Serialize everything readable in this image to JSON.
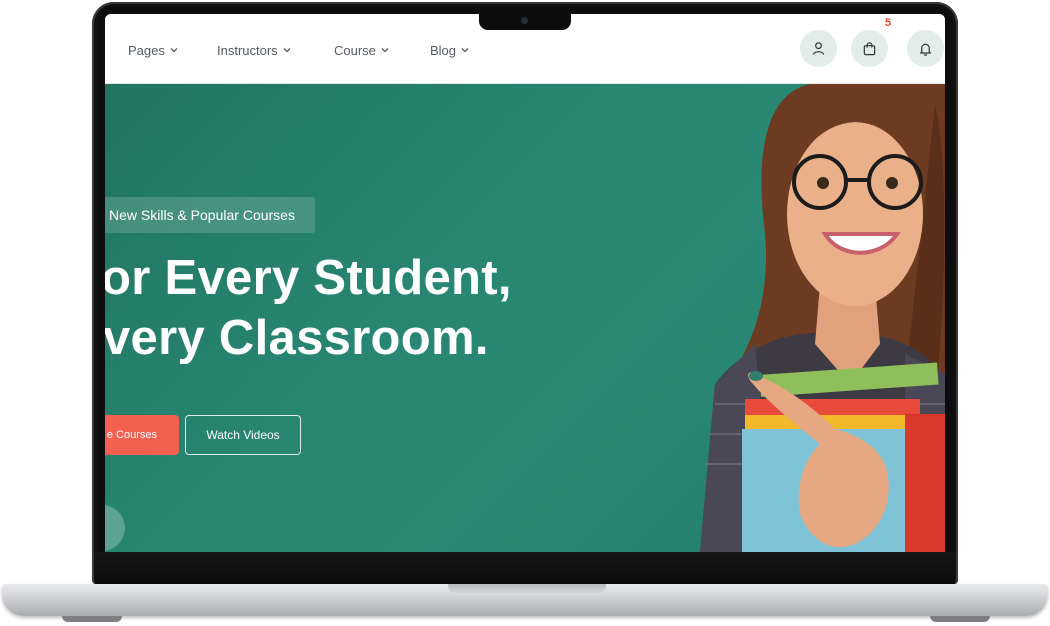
{
  "nav": {
    "items": [
      {
        "label": "Pages"
      },
      {
        "label": "Instructors"
      },
      {
        "label": "Course"
      },
      {
        "label": "Blog"
      }
    ],
    "cart_count": "5"
  },
  "hero": {
    "tag": "New Skills & Popular Courses",
    "headline_line1": "or Every Student,",
    "headline_line2": "very Classroom.",
    "primary_button": "e Courses",
    "secondary_button": "Watch Videos"
  },
  "colors": {
    "brand_green": "#278470",
    "accent_coral": "#f2604f",
    "badge_red": "#e4463b"
  },
  "icons": [
    "chevron-down-icon",
    "user-icon",
    "shopping-bag-icon",
    "bell-icon",
    "play-icon"
  ]
}
